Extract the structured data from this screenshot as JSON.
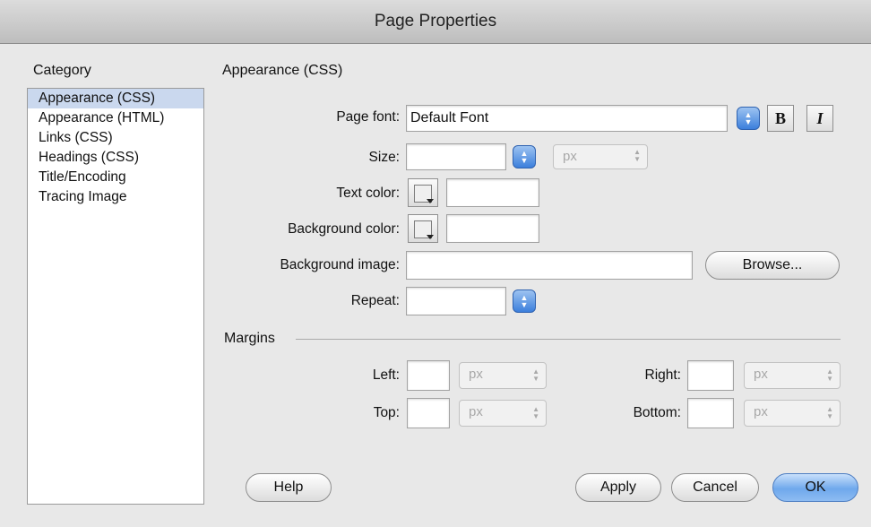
{
  "window": {
    "title": "Page Properties"
  },
  "category": {
    "label": "Category",
    "items": [
      "Appearance (CSS)",
      "Appearance (HTML)",
      "Links (CSS)",
      "Headings (CSS)",
      "Title/Encoding",
      "Tracing Image"
    ],
    "selected": "Appearance (CSS)"
  },
  "section": {
    "title": "Appearance (CSS)"
  },
  "form": {
    "page_font": {
      "label": "Page font:",
      "value": "Default Font",
      "bold_label": "B",
      "italic_label": "I"
    },
    "size": {
      "label": "Size:",
      "value": "",
      "unit": "px"
    },
    "text_color": {
      "label": "Text color:",
      "value": ""
    },
    "background_color": {
      "label": "Background color:",
      "value": ""
    },
    "background_image": {
      "label": "Background image:",
      "value": "",
      "browse_label": "Browse..."
    },
    "repeat": {
      "label": "Repeat:",
      "value": ""
    }
  },
  "margins": {
    "title": "Margins",
    "left": {
      "label": "Left:",
      "value": "",
      "unit": "px"
    },
    "right": {
      "label": "Right:",
      "value": "",
      "unit": "px"
    },
    "top": {
      "label": "Top:",
      "value": "",
      "unit": "px"
    },
    "bottom": {
      "label": "Bottom:",
      "value": "",
      "unit": "px"
    }
  },
  "buttons": {
    "help": "Help",
    "apply": "Apply",
    "cancel": "Cancel",
    "ok": "OK"
  },
  "colors": {
    "accent": "#6fa8ec",
    "selection": "#cad8ee"
  }
}
